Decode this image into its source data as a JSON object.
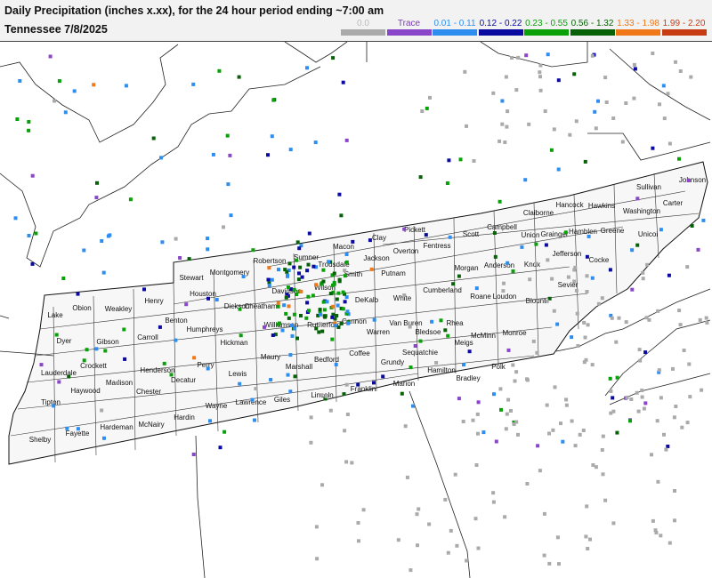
{
  "header": {
    "title": "Daily Precipitation (inches  x.xx),  for the 24 hour period ending ~7:00 am",
    "subtitle": "Tennessee 7/8/2025"
  },
  "legend": [
    {
      "label": "0.0",
      "color": "#aaaaaa",
      "text_color": "#bbbbbb"
    },
    {
      "label": "Trace",
      "color": "#8a46c8",
      "text_color": "#7a3ab8"
    },
    {
      "label": "0.01 - 0.11",
      "color": "#2d8ef0",
      "text_color": "#2d8ef0"
    },
    {
      "label": "0.12 - 0.22",
      "color": "#0a0aa0",
      "text_color": "#0a0aa0"
    },
    {
      "label": "0.23 - 0.55",
      "color": "#0aa00a",
      "text_color": "#0aa00a"
    },
    {
      "label": "0.56 - 1.32",
      "color": "#076207",
      "text_color": "#076207"
    },
    {
      "label": "1.33 - 1.98",
      "color": "#f07818",
      "text_color": "#f07818"
    },
    {
      "label": "1.99 - 2.20",
      "color": "#c83c14",
      "text_color": "#c83c14"
    }
  ],
  "counties": [
    "Shelby",
    "Fayette",
    "Hardeman",
    "McNairy",
    "Hardin",
    "Wayne",
    "Lawrence",
    "Giles",
    "Lincoln",
    "Franklin",
    "Marion",
    "Hamilton",
    "Bradley",
    "Polk",
    "Tipton",
    "Haywood",
    "Madison",
    "Chester",
    "Decatur",
    "Lewis",
    "Maury",
    "Marshall",
    "Bedford",
    "Coffee",
    "Grundy",
    "Sequatchie",
    "Meigs",
    "McMinn",
    "Monroe",
    "Lauderdale",
    "Crockett",
    "Henderson",
    "Perry",
    "Hickman",
    "Williamson",
    "Rutherford",
    "Cannon",
    "Warren",
    "Van Buren",
    "Bledsoe",
    "Rhea",
    "Roane",
    "Loudon",
    "Blount",
    "Dyer",
    "Gibson",
    "Carroll",
    "Benton",
    "Humphreys",
    "Dickson",
    "Cheatham",
    "Davidson",
    "Wilson",
    "DeKalb",
    "White",
    "Cumberland",
    "Morgan",
    "Anderson",
    "Knox",
    "Sevier",
    "Lake",
    "Obion",
    "Weakley",
    "Henry",
    "Houston",
    "Stewart",
    "Montgomery",
    "Robertson",
    "Sumner",
    "Trousdale",
    "Smith",
    "Putnam",
    "Jackson",
    "Clay",
    "Macon",
    "Overton",
    "Pickett",
    "Fentress",
    "Scott",
    "Campbell",
    "Union",
    "Grainger",
    "Jefferson",
    "Cocke",
    "Hamblen",
    "Greene",
    "Claiborne",
    "Hancock",
    "Hawkins",
    "Sullivan",
    "Washington",
    "Carter",
    "Unicoi",
    "Johnson"
  ]
}
